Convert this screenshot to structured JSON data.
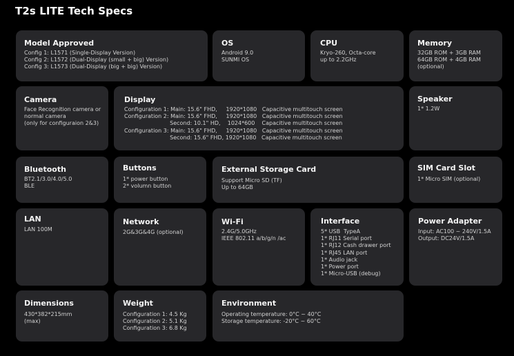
{
  "page": {
    "title": "T2s LITE Tech Specs"
  },
  "cards": {
    "model": {
      "title": "Model Approved",
      "lines": [
        "Config 1: L1571 (Single-Display Version)",
        "Config 2: L1572 (Dual-Display (small + big) Version)",
        "Config 3: L1573 (Dual-Display (big + big) Version)"
      ]
    },
    "os": {
      "title": "OS",
      "lines": [
        "Android 9.0",
        "SUNMI OS"
      ]
    },
    "cpu": {
      "title": "CPU",
      "lines": [
        "Kryo-260, Octa-core",
        "up to 2.2GHz"
      ]
    },
    "memory": {
      "title": "Memory",
      "lines": [
        "32GB ROM + 3GB RAM",
        "64GB ROM + 4GB RAM",
        "(optional)"
      ]
    },
    "camera": {
      "title": "Camera",
      "lines": [
        "Face Recognition camera or",
        "normal camera",
        "(only for configuraion 2&3)"
      ]
    },
    "display": {
      "title": "Display",
      "lines": [
        "Configuration 1: Main: 15.6\" FHD,     1920*1080   Capacitive multitouch screen",
        "Configuration 2: Main: 15.6\" FHD,     1920*1080   Capacitive multitouch screen",
        "                          Second: 10.1\" HD,    1024*600    Capacitive multitouch screen",
        "Configuration 3: Main: 15.6\" FHD,     1920*1080   Capacitive multitouch screen",
        "                          Second: 15.6\" FHD, 1920*1080   Capacitive multitouch screen"
      ]
    },
    "speaker": {
      "title": "Speaker",
      "lines": [
        "1* 1.2W"
      ]
    },
    "bluetooth": {
      "title": "Bluetooth",
      "lines": [
        "BT2.1/3.0/4.0/5.0",
        "BLE"
      ]
    },
    "buttons": {
      "title": "Buttons",
      "lines": [
        "1* power button",
        "2* volumn button"
      ]
    },
    "storage": {
      "title": "External Storage Card",
      "lines": [
        "Support Micro SD (TF)",
        "Up to 64GB"
      ]
    },
    "sim": {
      "title": "SIM Card Slot",
      "lines": [
        "1* Micro SIM (optional)"
      ]
    },
    "lan": {
      "title": "LAN",
      "lines": [
        "LAN 100M"
      ]
    },
    "network": {
      "title": "Network",
      "lines": [
        "2G&3G&4G (optional)"
      ]
    },
    "wifi": {
      "title": "Wi-Fi",
      "lines": [
        "2.4G/5.0GHz",
        "IEEE 802.11 a/b/g/n /ac"
      ]
    },
    "interface": {
      "title": "Interface",
      "lines": [
        "5* USB  TypeA",
        "1* RJ11 Serial port",
        "1* RJ12 Cash drawer port",
        "1* RJ45 LAN port",
        "1* Audio jack",
        "1* Power port",
        "1* Micro-USB (debug)"
      ]
    },
    "power": {
      "title": "Power Adapter",
      "lines": [
        "Input: AC100 ~ 240V/1.5A",
        "Output: DC24V/1.5A"
      ]
    },
    "dimensions": {
      "title": "Dimensions",
      "lines": [
        "430*382*215mm",
        "(max)"
      ]
    },
    "weight": {
      "title": "Weight",
      "lines": [
        "Configuration 1: 4.5 Kg",
        "Configuration 2: 5.1 Kg",
        "Configuration 3: 6.8 Kg"
      ]
    },
    "environment": {
      "title": "Environment",
      "lines": [
        "Operating temperature: 0°C ~ 40°C",
        "Storage temperature: -20°C ~ 60°C"
      ]
    }
  }
}
